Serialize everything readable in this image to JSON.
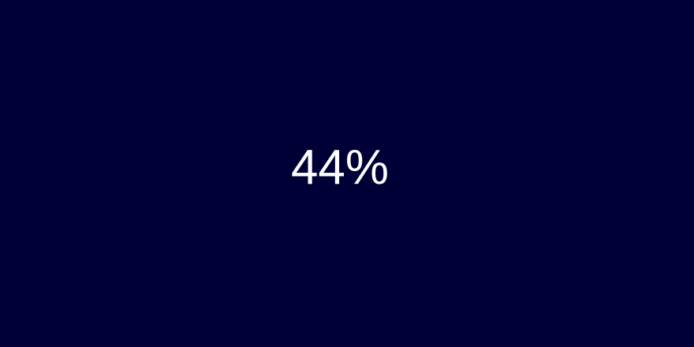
{
  "chart_data": {
    "type": "liquidfill",
    "value": 0.44,
    "label": "44%",
    "colors": {
      "background": "#000037",
      "front_wave": "#4f6fe3",
      "back_wave": "#bfe9ff",
      "label": "#ffffff"
    }
  }
}
